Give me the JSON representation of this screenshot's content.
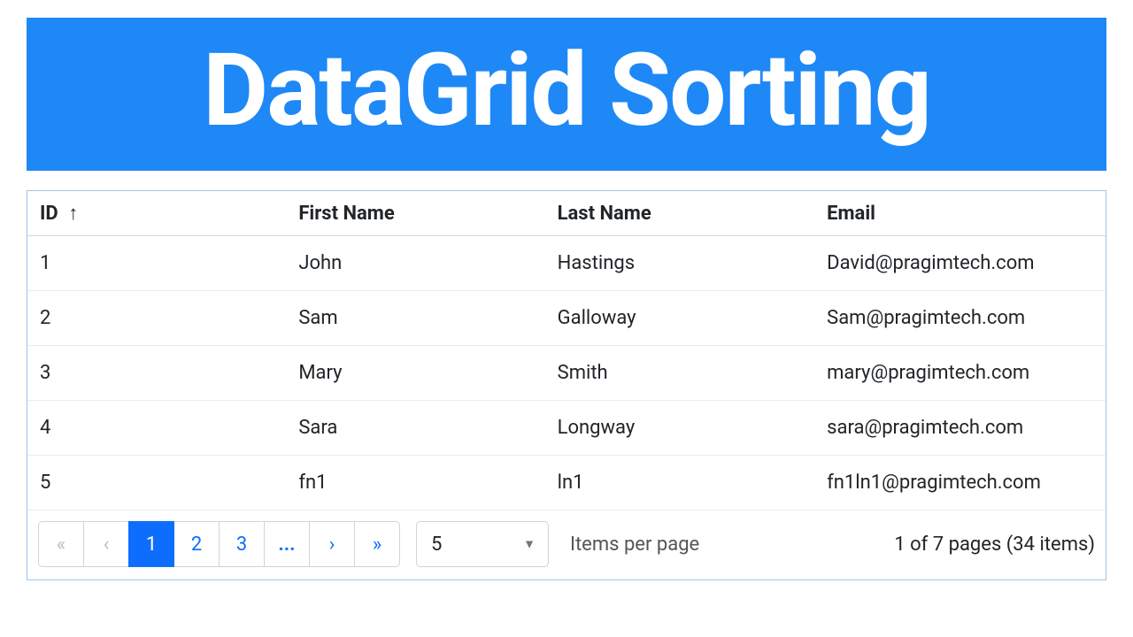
{
  "banner": {
    "title": "DataGrid Sorting"
  },
  "grid": {
    "columns": [
      {
        "label": "ID",
        "sorted": "asc"
      },
      {
        "label": "First Name",
        "sorted": null
      },
      {
        "label": "Last Name",
        "sorted": null
      },
      {
        "label": "Email",
        "sorted": null
      }
    ],
    "rows": [
      {
        "id": "1",
        "first": "John",
        "last": "Hastings",
        "email": "David@pragimtech.com"
      },
      {
        "id": "2",
        "first": "Sam",
        "last": "Galloway",
        "email": "Sam@pragimtech.com"
      },
      {
        "id": "3",
        "first": "Mary",
        "last": "Smith",
        "email": "mary@pragimtech.com"
      },
      {
        "id": "4",
        "first": "Sara",
        "last": "Longway",
        "email": "sara@pragimtech.com"
      },
      {
        "id": "5",
        "first": "fn1",
        "last": "ln1",
        "email": "fn1ln1@pragimtech.com"
      }
    ]
  },
  "pager": {
    "pages": [
      "1",
      "2",
      "3"
    ],
    "active_page": "1",
    "ellipsis": "...",
    "page_size_value": "5",
    "items_per_page_label": "Items per page",
    "page_info": "1 of 7 pages (34 items)"
  }
}
